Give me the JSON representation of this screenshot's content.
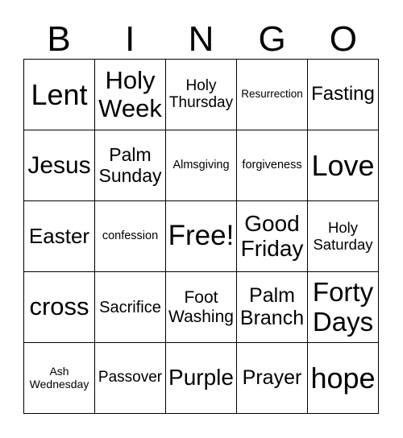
{
  "header": [
    "B",
    "I",
    "N",
    "G",
    "O"
  ],
  "cells": [
    [
      "Lent",
      "Holy Week",
      "Holy Thursday",
      "Resurrection",
      "Fasting"
    ],
    [
      "Jesus",
      "Palm Sunday",
      "Almsgiving",
      "forgiveness",
      "Love"
    ],
    [
      "Easter",
      "confession",
      "Free!",
      "Good Friday",
      "Holy Saturday"
    ],
    [
      "cross",
      "Sacrifice",
      "Foot Washing",
      "Palm Branch",
      "Forty Days"
    ],
    [
      "Ash Wednesday",
      "Passover",
      "Purple",
      "Prayer",
      "hope"
    ]
  ]
}
